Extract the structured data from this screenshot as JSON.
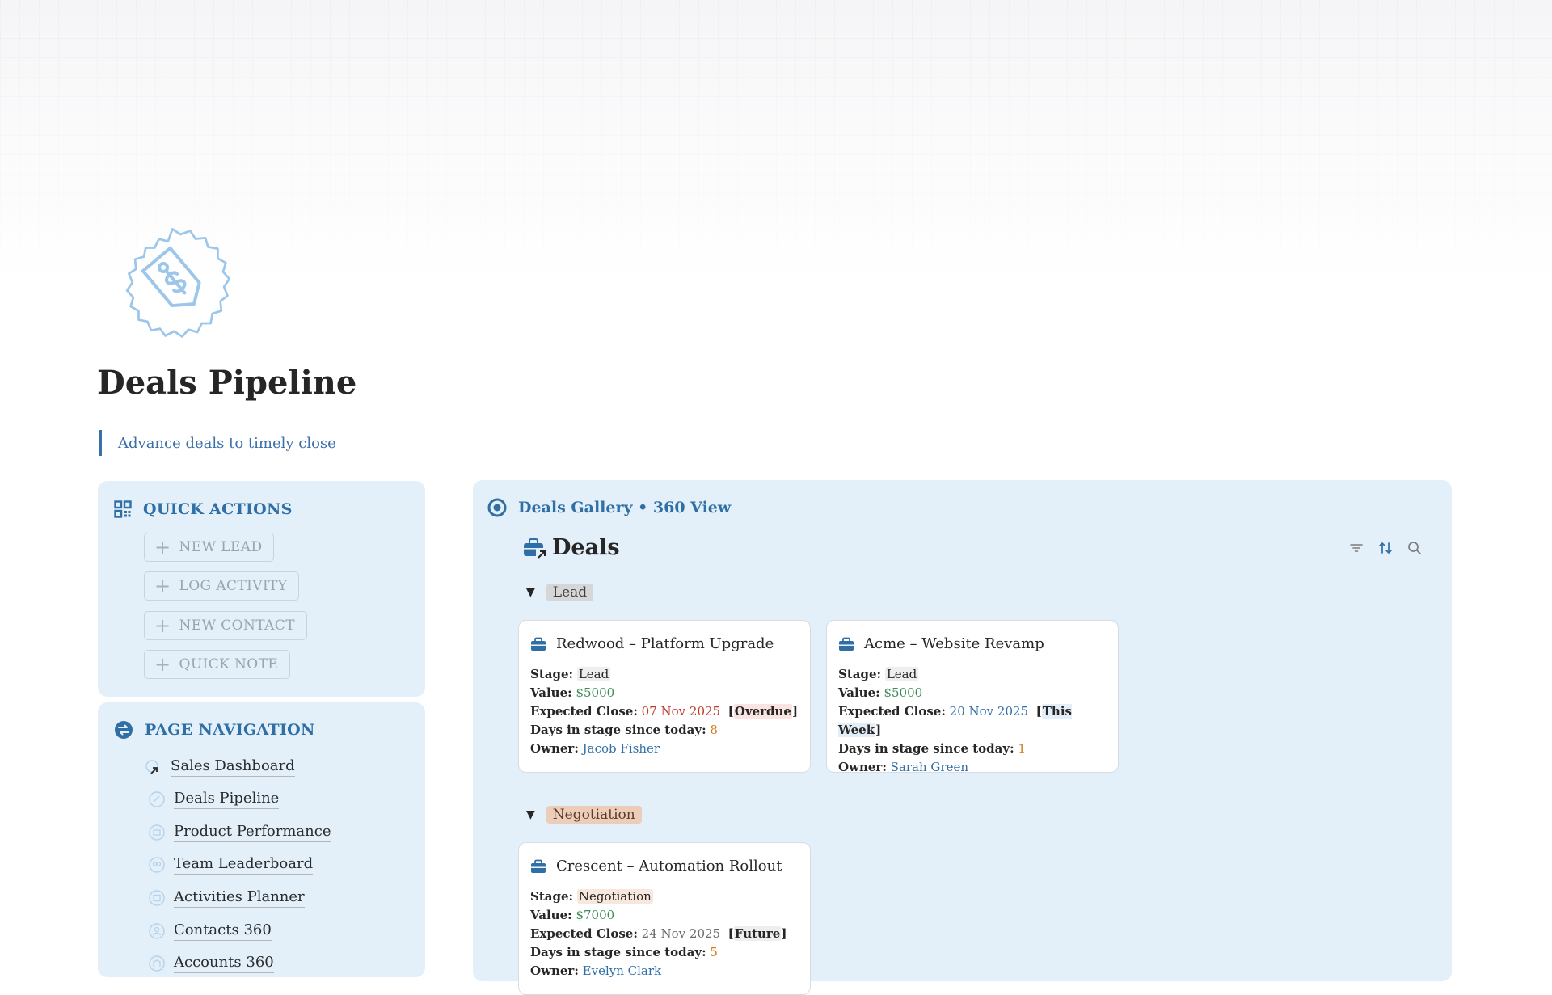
{
  "page": {
    "title": "Deals Pipeline",
    "subtitle": "Advance deals to timely close",
    "icon": "price-tag-icon",
    "accent_color": "#2f6fa6",
    "panel_color": "#e3eff9"
  },
  "quick_actions": {
    "title": "QUICK ACTIONS",
    "icon": "qr-grid-icon",
    "buttons": [
      {
        "label": "NEW LEAD"
      },
      {
        "label": "LOG ACTIVITY"
      },
      {
        "label": "NEW CONTACT"
      },
      {
        "label": "QUICK NOTE"
      }
    ]
  },
  "page_navigation": {
    "title": "PAGE NAVIGATION",
    "icon": "compass-icon",
    "links": [
      {
        "label": "Sales Dashboard",
        "icon": "dashboard-link-icon"
      },
      {
        "label": "Deals Pipeline",
        "icon": "pipeline-icon"
      },
      {
        "label": "Product Performance",
        "icon": "product-icon"
      },
      {
        "label": "Team Leaderboard",
        "icon": "team-icon"
      },
      {
        "label": "Activities Planner",
        "icon": "planner-icon"
      },
      {
        "label": "Contacts 360",
        "icon": "contact-icon"
      },
      {
        "label": "Accounts 360",
        "icon": "accounts-icon"
      }
    ]
  },
  "gallery": {
    "title": "Deals Gallery • 360 View",
    "database_title": "Deals",
    "groups": [
      {
        "name": "Lead",
        "cards": [
          {
            "title": "Redwood – Platform Upgrade",
            "stage_label": "Stage:",
            "stage": "Lead",
            "value_label": "Value:",
            "value": "$5000",
            "close_label": "Expected Close:",
            "close_date": "07 Nov 2025",
            "close_status": "Overdue",
            "days_label": "Days in stage since today:",
            "days": "8",
            "owner_label": "Owner:",
            "owner": "Jacob Fisher"
          },
          {
            "title": "Acme – Website Revamp",
            "stage_label": "Stage:",
            "stage": "Lead",
            "value_label": "Value:",
            "value": "$5000",
            "close_label": "Expected Close:",
            "close_date": "20 Nov 2025",
            "close_status": "This Week",
            "days_label": "Days in stage since today:",
            "days": "1",
            "owner_label": "Owner:",
            "owner": "Sarah Green"
          }
        ]
      },
      {
        "name": "Negotiation",
        "cards": [
          {
            "title": "Crescent – Automation Rollout",
            "stage_label": "Stage:",
            "stage": "Negotiation",
            "value_label": "Value:",
            "value": "$7000",
            "close_label": "Expected Close:",
            "close_date": "24 Nov 2025",
            "close_status": "Future",
            "days_label": "Days in stage since today:",
            "days": "5",
            "owner_label": "Owner:",
            "owner": "Evelyn Clark"
          }
        ]
      }
    ]
  }
}
